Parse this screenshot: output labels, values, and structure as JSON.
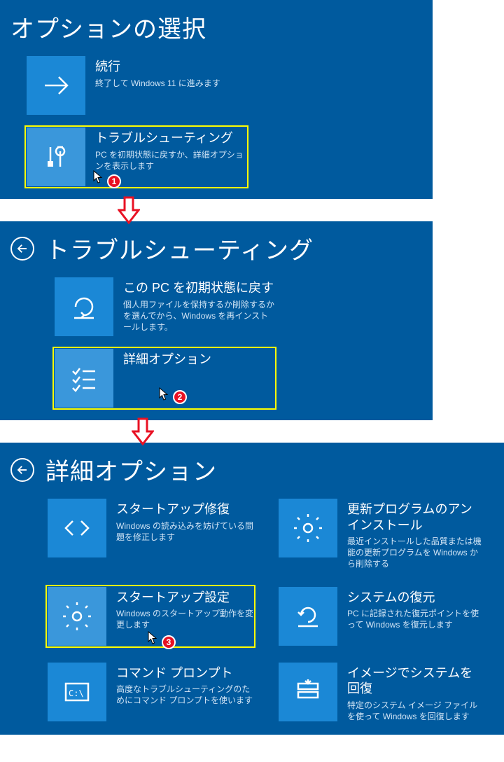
{
  "screen1": {
    "title": "オプションの選択",
    "tiles": {
      "continue": {
        "title": "続行",
        "desc": "終了して Windows 11\nに進みます"
      },
      "troubleshoot": {
        "title": "トラブルシューティング",
        "desc": "PC を初期状態に戻すか、詳細オプションを表示します"
      }
    }
  },
  "screen2": {
    "title": "トラブルシューティング",
    "tiles": {
      "reset": {
        "title": "この PC を初期状態に戻す",
        "desc": "個人用ファイルを保持するか削除するかを選んでから、Windows を再インストールします。"
      },
      "advanced": {
        "title": "詳細オプション",
        "desc": ""
      }
    }
  },
  "screen3": {
    "title": "詳細オプション",
    "tiles": {
      "startup_repair": {
        "title": "スタートアップ修復",
        "desc": "Windows の読み込みを妨げている問題を修正します"
      },
      "uninstall_updates": {
        "title": "更新プログラムのアンインストール",
        "desc": "最近インストールした品質または機能の更新プログラムを Windows から削除する"
      },
      "startup_settings": {
        "title": "スタートアップ設定",
        "desc": "Windows のスタートアップ動作を変更します"
      },
      "system_restore": {
        "title": "システムの復元",
        "desc": "PC に記録された復元ポイントを使って Windows を復元します"
      },
      "command_prompt": {
        "title": "コマンド プロンプト",
        "desc": "高度なトラブルシューティングのためにコマンド プロンプトを使います"
      },
      "image_recovery": {
        "title": "イメージでシステムを回復",
        "desc": "特定のシステム イメージ ファイルを使って Windows を回復します"
      }
    }
  },
  "badges": {
    "b1": "1",
    "b2": "2",
    "b3": "3"
  }
}
